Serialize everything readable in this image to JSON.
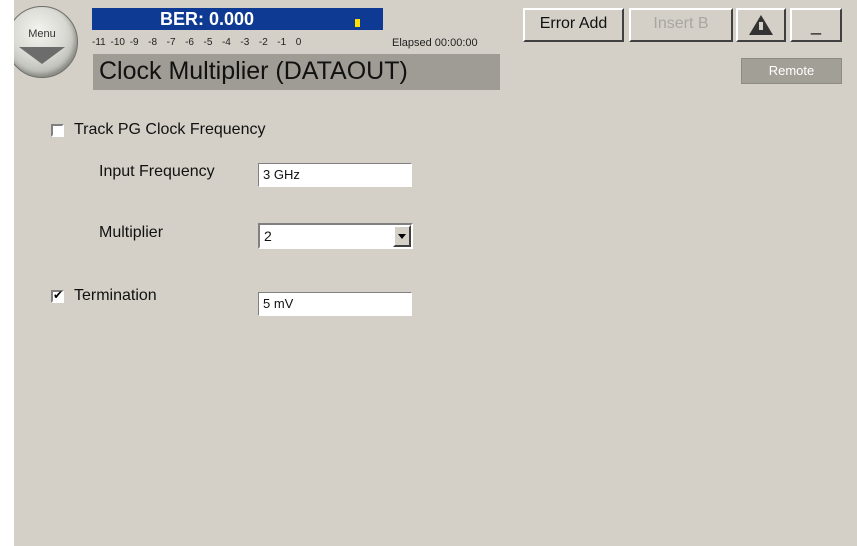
{
  "header": {
    "menu_label": "Menu",
    "ber_text": "BER: 0.000",
    "ber_scale": "-11 -10 -9  -8  -7  -6  -5  -4  -3  -2  -1  0",
    "elapsed_label": "Elapsed 00:00:00",
    "page_title": "Clock Multiplier (DATAOUT)",
    "remote_label": "Remote"
  },
  "toolbar": {
    "error_add_label": "Error Add",
    "insert_b_label": "Insert B",
    "minimize_label": "_"
  },
  "form": {
    "track_pg": {
      "label": "Track PG Clock Frequency",
      "checked": false
    },
    "input_frequency": {
      "label": "Input Frequency",
      "value": "3 GHz"
    },
    "multiplier": {
      "label": "Multiplier",
      "value": "2"
    },
    "termination": {
      "label": "Termination",
      "checked": true,
      "value": "5 mV"
    }
  },
  "colors": {
    "background": "#d4d0c8",
    "ber_panel": "#0e3a94",
    "title_bar": "#9e9c94",
    "remote_box": "#a29f97"
  },
  "icons": [
    "menu-arrow-icon",
    "ber-marker-icon",
    "warning-icon",
    "checkmark-icon",
    "dropdown-arrow-icon"
  ]
}
